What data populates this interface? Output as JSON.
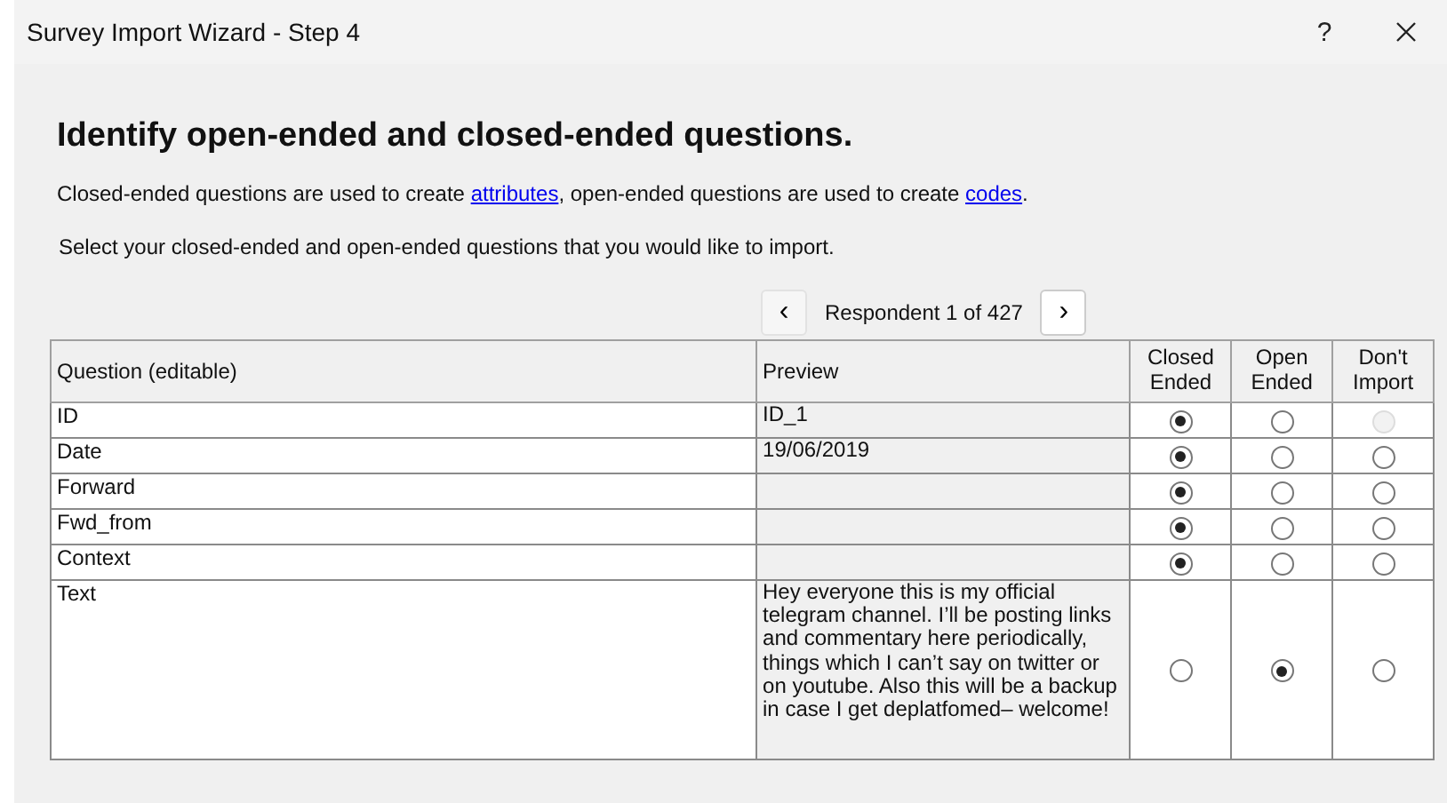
{
  "window": {
    "title": "Survey Import Wizard - Step 4",
    "help": "?"
  },
  "heading": "Identify open-ended and closed-ended questions.",
  "intro": {
    "before": "Closed-ended questions are used to create ",
    "link1": "attributes",
    "middle": ", open-ended questions are used to create ",
    "link2": "codes",
    "after": "."
  },
  "instruction": "Select your closed-ended and open-ended questions that you would like to import.",
  "navigator": {
    "prev": "‹",
    "label": "Respondent 1 of 427",
    "next": "›"
  },
  "table": {
    "columns": [
      "Question (editable)",
      "Preview",
      "Closed Ended",
      "Open Ended",
      "Don't Import"
    ],
    "rows": [
      {
        "question": "ID",
        "preview": "ID_1",
        "options": [
          {
            "selected": true,
            "disabled": false
          },
          {
            "selected": false,
            "disabled": false
          },
          {
            "selected": false,
            "disabled": true
          }
        ]
      },
      {
        "question": "Date",
        "preview": "19/06/2019",
        "options": [
          {
            "selected": true,
            "disabled": false
          },
          {
            "selected": false,
            "disabled": false
          },
          {
            "selected": false,
            "disabled": false
          }
        ]
      },
      {
        "question": "Forward",
        "options": [
          {
            "selected": true,
            "disabled": false
          },
          {
            "selected": false,
            "disabled": false
          },
          {
            "selected": false,
            "disabled": false
          }
        ]
      },
      {
        "question": "Fwd_from",
        "options": [
          {
            "selected": true,
            "disabled": false
          },
          {
            "selected": false,
            "disabled": false
          },
          {
            "selected": false,
            "disabled": false
          }
        ]
      },
      {
        "question": "Context",
        "options": [
          {
            "selected": true,
            "disabled": false
          },
          {
            "selected": false,
            "disabled": false
          },
          {
            "selected": false,
            "disabled": false
          }
        ]
      },
      {
        "question": "Text",
        "preview": "Hey everyone this is my official telegram channel. I’ll be posting links and commentary here periodically, things which I can’t say on twitter or on youtube. Also this will be a backup in case I get deplatfomed– welcome!",
        "options": [
          {
            "selected": false,
            "disabled": false
          },
          {
            "selected": true,
            "disabled": false
          },
          {
            "selected": false,
            "disabled": false
          }
        ]
      }
    ]
  }
}
